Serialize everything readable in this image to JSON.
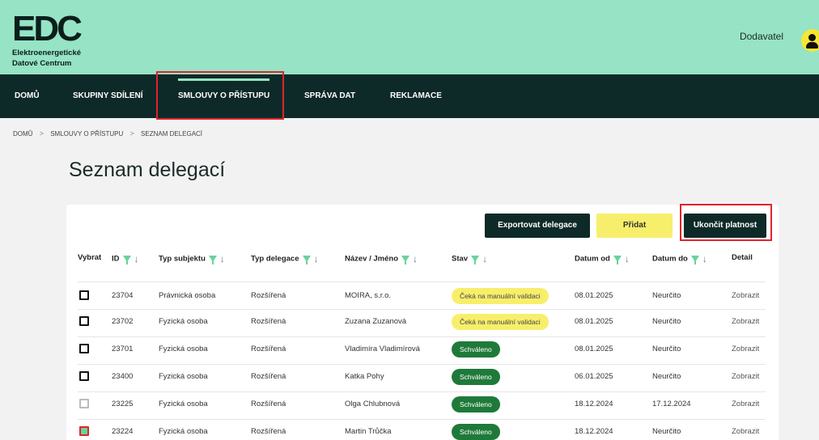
{
  "header": {
    "logo_mark": "EDC",
    "logo_line1": "Elektroenergetické",
    "logo_line2": "Datové Centrum",
    "user_name": "Dodavatel"
  },
  "nav": {
    "items": [
      {
        "label": "DOMŮ"
      },
      {
        "label": "SKUPINY SDÍLENÍ"
      },
      {
        "label": "SMLOUVY O PŘÍSTUPU"
      },
      {
        "label": "SPRÁVA DAT"
      },
      {
        "label": "REKLAMACE"
      }
    ]
  },
  "breadcrumb": {
    "items": [
      "DOMŮ",
      "SMLOUVY O PŘÍSTUPU",
      "SEZNAM DELEGACÍ"
    ]
  },
  "page": {
    "title": "Seznam delegací"
  },
  "toolbar": {
    "export_label": "Exportovat delegace",
    "add_label": "Přidat",
    "end_label": "Ukončit platnost"
  },
  "table": {
    "headers": [
      "Vybrat",
      "ID",
      "Typ subjektu",
      "Typ delegace",
      "Název / Jméno",
      "Stav",
      "Datum od",
      "Datum do",
      "Detail"
    ],
    "rows": [
      {
        "id": "23704",
        "subject": "Právnická osoba",
        "type": "Rozšířená",
        "name": "MOIRA, s.r.o.",
        "status": "Čeká na manuální validaci",
        "status_kind": "wait",
        "from": "08.01.2025",
        "to": "Neurčito",
        "detail": "Zobrazit",
        "checkbox": "unchecked"
      },
      {
        "id": "23702",
        "subject": "Fyzická osoba",
        "type": "Rozšířená",
        "name": "Zuzana Zuzanová",
        "status": "Čeká na manuální validaci",
        "status_kind": "wait",
        "from": "08.01.2025",
        "to": "Neurčito",
        "detail": "Zobrazit",
        "checkbox": "unchecked"
      },
      {
        "id": "23701",
        "subject": "Fyzická osoba",
        "type": "Rozšířená",
        "name": "Vladimíra Vladimírová",
        "status": "Schváleno",
        "status_kind": "ok",
        "from": "08.01.2025",
        "to": "Neurčito",
        "detail": "Zobrazit",
        "checkbox": "unchecked"
      },
      {
        "id": "23400",
        "subject": "Fyzická osoba",
        "type": "Rozšířená",
        "name": "Katka Pohy",
        "status": "Schváleno",
        "status_kind": "ok",
        "from": "06.01.2025",
        "to": "Neurčito",
        "detail": "Zobrazit",
        "checkbox": "unchecked"
      },
      {
        "id": "23225",
        "subject": "Fyzická osoba",
        "type": "Rozšířená",
        "name": "Olga Chlubnová",
        "status": "Schváleno",
        "status_kind": "ok",
        "from": "18.12.2024",
        "to": "17.12.2024",
        "detail": "Zobrazit",
        "checkbox": "disabled"
      },
      {
        "id": "23224",
        "subject": "Fyzická osoba",
        "type": "Rozšířená",
        "name": "Martin Trůčka",
        "status": "Schváleno",
        "status_kind": "ok",
        "from": "18.12.2024",
        "to": "Neurčito",
        "detail": "Zobrazit",
        "checkbox": "checked"
      }
    ]
  },
  "colors": {
    "header_bg": "#96e3c5",
    "nav_bg": "#0e2a28",
    "accent_yellow": "#f7ef6b",
    "approved_green": "#1f7a3a",
    "filter_green": "#69d39b",
    "highlight_red": "#e0242a"
  }
}
